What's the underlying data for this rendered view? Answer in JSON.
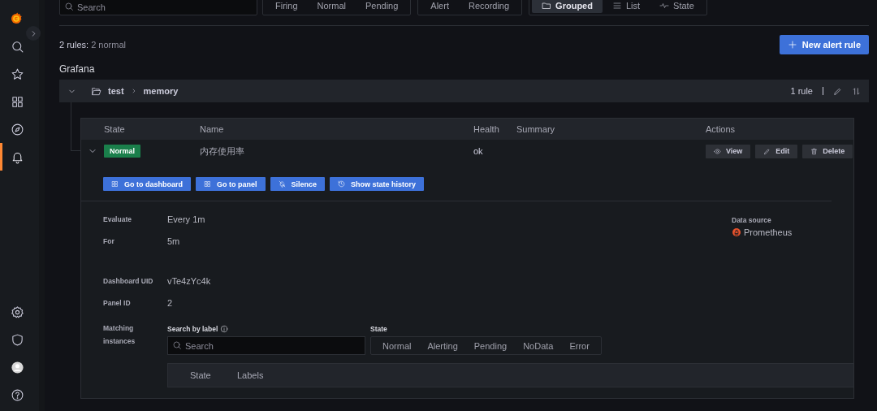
{
  "sidebar": {
    "items": [
      {
        "selected": false
      },
      {
        "selected": false
      },
      {
        "selected": false
      },
      {
        "selected": false
      },
      {
        "selected": true
      }
    ],
    "bottom_items": [
      {
        "selected": false
      },
      {
        "selected": false
      },
      {
        "selected": false
      },
      {
        "selected": false
      }
    ]
  },
  "toolbar": {
    "search": {
      "placeholder": "Search"
    },
    "state_filters": [
      {
        "label": "Firing",
        "selected": false
      },
      {
        "label": "Normal",
        "selected": false
      },
      {
        "label": "Pending",
        "selected": false
      }
    ],
    "type_filters": [
      {
        "label": "Alert",
        "selected": false
      },
      {
        "label": "Recording",
        "selected": false
      }
    ],
    "view_modes": [
      {
        "label": "Grouped",
        "selected": true
      },
      {
        "label": "List",
        "selected": false
      },
      {
        "label": "State",
        "selected": false
      }
    ]
  },
  "summary": {
    "count": "2 rules:",
    "detail": "2 normal"
  },
  "new_rule_button": "New alert rule",
  "section_title": "Grafana",
  "group": {
    "folder": "test",
    "name": "memory",
    "expanded": true,
    "rule_count": "1 rule",
    "columns": [
      "State",
      "Name",
      "Health",
      "Summary",
      "Actions"
    ],
    "rules": [
      {
        "state": "Normal",
        "name": "内存使用率",
        "health": "ok",
        "expanded": true,
        "actions": [
          "View",
          "Edit",
          "Delete"
        ],
        "links": [
          "Go to dashboard",
          "Go to panel",
          "Silence",
          "Show state history"
        ],
        "details": [
          {
            "label": "Evaluate",
            "value": "Every 1m"
          },
          {
            "label": "For",
            "value": "5m"
          },
          {
            "label": "Dashboard UID",
            "value": "vTe4zYc4k"
          },
          {
            "label": "Panel ID",
            "value": "2"
          }
        ],
        "data_source": {
          "label": "Data source",
          "name": "Prometheus"
        },
        "instances": {
          "label": "Matching instances",
          "search_label": "Search by label",
          "placeholder": "Search",
          "state_label": "State",
          "state_filters": [
            {
              "label": "Normal",
              "selected": false
            },
            {
              "label": "Alerting",
              "selected": false
            },
            {
              "label": "Pending",
              "selected": false
            },
            {
              "label": "NoData",
              "selected": false
            },
            {
              "label": "Error",
              "selected": false
            }
          ],
          "columns": [
            "State",
            "Labels"
          ]
        }
      }
    ]
  }
}
